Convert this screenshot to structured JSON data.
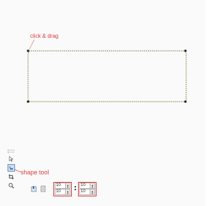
{
  "annotations": {
    "drag_label": "click & drag",
    "shape_tool_label": "shape tool"
  },
  "toolbox": {
    "tools": [
      {
        "name": "pick-tool",
        "icon": "arrow-icon"
      },
      {
        "name": "shape-tool",
        "icon": "shape-icon",
        "active": true
      },
      {
        "name": "crop-tool",
        "icon": "crop-icon"
      },
      {
        "name": "zoom-tool",
        "icon": "zoom-icon"
      }
    ]
  },
  "property_bar": {
    "group_left": {
      "top_value": "10",
      "bottom_value": "10"
    },
    "group_right": {
      "top_value": "10",
      "bottom_value": "10"
    }
  },
  "colors": {
    "annotation": "#e03a3a",
    "shape_outline": "#8a8a55",
    "node": "#111111",
    "active_tool": "#c9dcf0"
  }
}
